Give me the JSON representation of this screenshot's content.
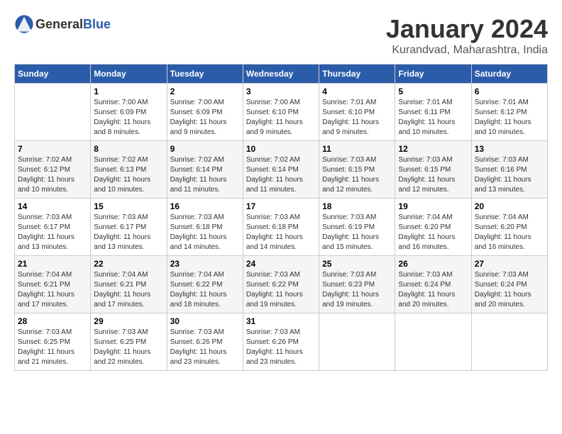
{
  "logo": {
    "text_general": "General",
    "text_blue": "Blue"
  },
  "title": "January 2024",
  "location": "Kurandvad, Maharashtra, India",
  "days_of_week": [
    "Sunday",
    "Monday",
    "Tuesday",
    "Wednesday",
    "Thursday",
    "Friday",
    "Saturday"
  ],
  "weeks": [
    [
      {
        "day": "",
        "info": ""
      },
      {
        "day": "1",
        "info": "Sunrise: 7:00 AM\nSunset: 6:09 PM\nDaylight: 11 hours\nand 8 minutes."
      },
      {
        "day": "2",
        "info": "Sunrise: 7:00 AM\nSunset: 6:09 PM\nDaylight: 11 hours\nand 9 minutes."
      },
      {
        "day": "3",
        "info": "Sunrise: 7:00 AM\nSunset: 6:10 PM\nDaylight: 11 hours\nand 9 minutes."
      },
      {
        "day": "4",
        "info": "Sunrise: 7:01 AM\nSunset: 6:10 PM\nDaylight: 11 hours\nand 9 minutes."
      },
      {
        "day": "5",
        "info": "Sunrise: 7:01 AM\nSunset: 6:11 PM\nDaylight: 11 hours\nand 10 minutes."
      },
      {
        "day": "6",
        "info": "Sunrise: 7:01 AM\nSunset: 6:12 PM\nDaylight: 11 hours\nand 10 minutes."
      }
    ],
    [
      {
        "day": "7",
        "info": "Sunrise: 7:02 AM\nSunset: 6:12 PM\nDaylight: 11 hours\nand 10 minutes."
      },
      {
        "day": "8",
        "info": "Sunrise: 7:02 AM\nSunset: 6:13 PM\nDaylight: 11 hours\nand 10 minutes."
      },
      {
        "day": "9",
        "info": "Sunrise: 7:02 AM\nSunset: 6:14 PM\nDaylight: 11 hours\nand 11 minutes."
      },
      {
        "day": "10",
        "info": "Sunrise: 7:02 AM\nSunset: 6:14 PM\nDaylight: 11 hours\nand 11 minutes."
      },
      {
        "day": "11",
        "info": "Sunrise: 7:03 AM\nSunset: 6:15 PM\nDaylight: 11 hours\nand 12 minutes."
      },
      {
        "day": "12",
        "info": "Sunrise: 7:03 AM\nSunset: 6:15 PM\nDaylight: 11 hours\nand 12 minutes."
      },
      {
        "day": "13",
        "info": "Sunrise: 7:03 AM\nSunset: 6:16 PM\nDaylight: 11 hours\nand 13 minutes."
      }
    ],
    [
      {
        "day": "14",
        "info": "Sunrise: 7:03 AM\nSunset: 6:17 PM\nDaylight: 11 hours\nand 13 minutes."
      },
      {
        "day": "15",
        "info": "Sunrise: 7:03 AM\nSunset: 6:17 PM\nDaylight: 11 hours\nand 13 minutes."
      },
      {
        "day": "16",
        "info": "Sunrise: 7:03 AM\nSunset: 6:18 PM\nDaylight: 11 hours\nand 14 minutes."
      },
      {
        "day": "17",
        "info": "Sunrise: 7:03 AM\nSunset: 6:18 PM\nDaylight: 11 hours\nand 14 minutes."
      },
      {
        "day": "18",
        "info": "Sunrise: 7:03 AM\nSunset: 6:19 PM\nDaylight: 11 hours\nand 15 minutes."
      },
      {
        "day": "19",
        "info": "Sunrise: 7:04 AM\nSunset: 6:20 PM\nDaylight: 11 hours\nand 16 minutes."
      },
      {
        "day": "20",
        "info": "Sunrise: 7:04 AM\nSunset: 6:20 PM\nDaylight: 11 hours\nand 16 minutes."
      }
    ],
    [
      {
        "day": "21",
        "info": "Sunrise: 7:04 AM\nSunset: 6:21 PM\nDaylight: 11 hours\nand 17 minutes."
      },
      {
        "day": "22",
        "info": "Sunrise: 7:04 AM\nSunset: 6:21 PM\nDaylight: 11 hours\nand 17 minutes."
      },
      {
        "day": "23",
        "info": "Sunrise: 7:04 AM\nSunset: 6:22 PM\nDaylight: 11 hours\nand 18 minutes."
      },
      {
        "day": "24",
        "info": "Sunrise: 7:03 AM\nSunset: 6:22 PM\nDaylight: 11 hours\nand 19 minutes."
      },
      {
        "day": "25",
        "info": "Sunrise: 7:03 AM\nSunset: 6:23 PM\nDaylight: 11 hours\nand 19 minutes."
      },
      {
        "day": "26",
        "info": "Sunrise: 7:03 AM\nSunset: 6:24 PM\nDaylight: 11 hours\nand 20 minutes."
      },
      {
        "day": "27",
        "info": "Sunrise: 7:03 AM\nSunset: 6:24 PM\nDaylight: 11 hours\nand 20 minutes."
      }
    ],
    [
      {
        "day": "28",
        "info": "Sunrise: 7:03 AM\nSunset: 6:25 PM\nDaylight: 11 hours\nand 21 minutes."
      },
      {
        "day": "29",
        "info": "Sunrise: 7:03 AM\nSunset: 6:25 PM\nDaylight: 11 hours\nand 22 minutes."
      },
      {
        "day": "30",
        "info": "Sunrise: 7:03 AM\nSunset: 6:26 PM\nDaylight: 11 hours\nand 23 minutes."
      },
      {
        "day": "31",
        "info": "Sunrise: 7:03 AM\nSunset: 6:26 PM\nDaylight: 11 hours\nand 23 minutes."
      },
      {
        "day": "",
        "info": ""
      },
      {
        "day": "",
        "info": ""
      },
      {
        "day": "",
        "info": ""
      }
    ]
  ]
}
